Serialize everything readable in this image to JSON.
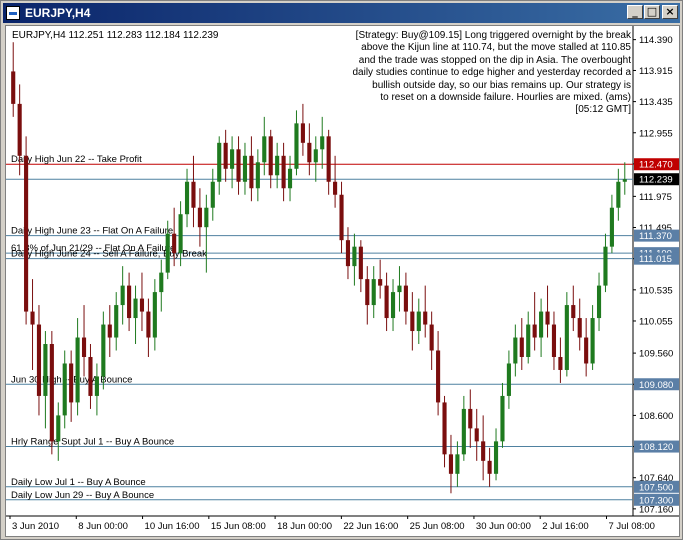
{
  "window": {
    "title": "EURJPY,H4",
    "min_label": "_",
    "max_label": "□",
    "close_label": "×"
  },
  "header": {
    "symbol_line": "EURJPY,H4  112.251 112.283 112.184 112.239"
  },
  "commentary": "[Strategy: Buy@109.15] Long triggered overnight by the break\nabove the Kijun line at 110.74, but the move stalled at 110.85\nand the trade was stopped on the dip in Asia. The overbought\ndaily studies continue to edge higher and yesterday recorded a\nbullish outside day, so our bias remains up. Our strategy is\nto reset on a downside failure. Hourlies are mixed. (ams)\n[05:12 GMT]",
  "colors": {
    "bull": "#1f7a1f",
    "bear": "#7a0e0e",
    "level_line": "#4f81a0",
    "tp_line": "#c00000",
    "current_tag": "#000000",
    "level_tag": "#5b7fa6"
  },
  "chart_data": {
    "type": "candlestick",
    "ylim": [
      107.16,
      114.5
    ],
    "price_ticks": [
      "114.390",
      "113.915",
      "113.435",
      "112.955",
      "112.475",
      "111.975",
      "111.495",
      "111.015",
      "110.535",
      "110.055",
      "109.560",
      "109.080",
      "108.600",
      "108.120",
      "107.640",
      "107.160"
    ],
    "x_ticks": [
      "3 Jun 2010",
      "8 Jun 00:00",
      "10 Jun 16:00",
      "15 Jun 08:00",
      "18 Jun 00:00",
      "22 Jun 16:00",
      "25 Jun 08:00",
      "30 Jun 00:00",
      "2 Jul 16:00",
      "7 Jul 08:00"
    ],
    "current_price": {
      "value": 112.239,
      "label": "112.239"
    },
    "levels": [
      {
        "text": "Daily High Jun 22 -- Take Profit",
        "price": 112.47,
        "tag": "112.470",
        "kind": "tp"
      },
      {
        "text": "Daily High June 23 -- Flat On A Failure",
        "price": 111.37,
        "tag": "111.370",
        "kind": "level"
      },
      {
        "text": "61.8% of Jun 21/29 -- Flat On A Failure",
        "price": 111.1,
        "tag": "111.100",
        "kind": "level"
      },
      {
        "text": "Daily High June 24 -- Sell A Failure, Buy Break",
        "price": 111.015,
        "tag": "111.015",
        "kind": "level"
      },
      {
        "text": "Jun 30 High -- Buy A Bounce",
        "price": 109.08,
        "tag": "109.080",
        "kind": "level"
      },
      {
        "text": "Hrly Range Supt Jul 1 -- Buy A Bounce",
        "price": 108.12,
        "tag": "108.120",
        "kind": "level"
      },
      {
        "text": "Daily Low Jul 1 -- Buy A Bounce",
        "price": 107.5,
        "tag": "107.500",
        "kind": "level"
      },
      {
        "text": "Daily Low Jun 29 -- Buy A Bounce",
        "price": 107.3,
        "tag": "107.300",
        "kind": "level"
      }
    ],
    "ohlc": [
      [
        113.9,
        114.35,
        113.2,
        113.4
      ],
      [
        113.4,
        113.7,
        112.3,
        112.6
      ],
      [
        112.6,
        112.9,
        110.0,
        110.2
      ],
      [
        110.2,
        110.7,
        109.3,
        110.0
      ],
      [
        110.0,
        110.3,
        108.6,
        108.9
      ],
      [
        108.9,
        109.9,
        108.4,
        109.7
      ],
      [
        109.7,
        109.9,
        108.0,
        108.2
      ],
      [
        108.2,
        108.8,
        107.9,
        108.6
      ],
      [
        108.6,
        109.6,
        108.4,
        109.4
      ],
      [
        109.4,
        109.6,
        108.5,
        108.8
      ],
      [
        108.8,
        110.1,
        108.6,
        109.8
      ],
      [
        109.8,
        110.3,
        109.2,
        109.5
      ],
      [
        109.5,
        109.7,
        108.7,
        108.9
      ],
      [
        108.9,
        109.4,
        108.6,
        109.2
      ],
      [
        109.2,
        110.2,
        109.0,
        110.0
      ],
      [
        110.0,
        110.3,
        109.5,
        109.8
      ],
      [
        109.8,
        110.5,
        109.6,
        110.3
      ],
      [
        110.3,
        110.9,
        110.0,
        110.6
      ],
      [
        110.6,
        110.8,
        109.9,
        110.1
      ],
      [
        110.1,
        110.6,
        109.7,
        110.4
      ],
      [
        110.4,
        110.8,
        109.9,
        110.2
      ],
      [
        110.2,
        110.4,
        109.5,
        109.8
      ],
      [
        109.8,
        110.7,
        109.6,
        110.5
      ],
      [
        110.5,
        111.0,
        110.2,
        110.8
      ],
      [
        110.8,
        111.6,
        110.7,
        111.4
      ],
      [
        111.4,
        111.8,
        110.9,
        111.1
      ],
      [
        111.1,
        111.9,
        110.9,
        111.7
      ],
      [
        111.7,
        112.4,
        111.5,
        112.2
      ],
      [
        112.2,
        112.6,
        111.5,
        111.8
      ],
      [
        111.8,
        112.1,
        111.2,
        111.5
      ],
      [
        111.5,
        112.0,
        110.8,
        111.8
      ],
      [
        111.8,
        112.4,
        111.6,
        112.2
      ],
      [
        112.2,
        112.9,
        112.0,
        112.8
      ],
      [
        112.8,
        113.0,
        112.2,
        112.4
      ],
      [
        112.4,
        112.9,
        112.1,
        112.7
      ],
      [
        112.7,
        112.9,
        112.0,
        112.2
      ],
      [
        112.2,
        112.8,
        112.0,
        112.6
      ],
      [
        112.6,
        112.9,
        111.9,
        112.1
      ],
      [
        112.1,
        112.7,
        111.9,
        112.5
      ],
      [
        112.5,
        113.2,
        112.3,
        112.9
      ],
      [
        112.9,
        113.0,
        112.1,
        112.3
      ],
      [
        112.3,
        112.8,
        112.1,
        112.6
      ],
      [
        112.6,
        112.8,
        111.9,
        112.1
      ],
      [
        112.1,
        112.6,
        111.9,
        112.4
      ],
      [
        112.4,
        113.3,
        112.3,
        113.1
      ],
      [
        113.1,
        113.4,
        112.6,
        112.8
      ],
      [
        112.8,
        113.1,
        112.3,
        112.5
      ],
      [
        112.5,
        112.9,
        112.2,
        112.7
      ],
      [
        112.7,
        113.2,
        112.4,
        112.9
      ],
      [
        112.9,
        113.0,
        112.0,
        112.2
      ],
      [
        112.2,
        112.6,
        111.8,
        112.0
      ],
      [
        112.0,
        112.2,
        111.1,
        111.3
      ],
      [
        111.3,
        111.5,
        110.7,
        110.9
      ],
      [
        110.9,
        111.4,
        110.6,
        111.2
      ],
      [
        111.2,
        111.3,
        110.5,
        110.7
      ],
      [
        110.7,
        110.9,
        110.0,
        110.3
      ],
      [
        110.3,
        110.9,
        110.1,
        110.7
      ],
      [
        110.7,
        111.0,
        110.4,
        110.6
      ],
      [
        110.6,
        110.8,
        109.9,
        110.1
      ],
      [
        110.1,
        110.7,
        109.9,
        110.5
      ],
      [
        110.5,
        110.9,
        110.2,
        110.6
      ],
      [
        110.6,
        110.8,
        110.0,
        110.2
      ],
      [
        110.2,
        110.5,
        109.6,
        109.9
      ],
      [
        109.9,
        110.4,
        109.7,
        110.2
      ],
      [
        110.2,
        110.6,
        109.8,
        110.0
      ],
      [
        110.0,
        110.2,
        109.3,
        109.6
      ],
      [
        109.6,
        109.9,
        108.6,
        108.8
      ],
      [
        108.8,
        108.9,
        107.8,
        108.0
      ],
      [
        108.0,
        108.3,
        107.4,
        107.7
      ],
      [
        107.7,
        108.2,
        107.5,
        108.0
      ],
      [
        108.0,
        108.9,
        107.9,
        108.7
      ],
      [
        108.7,
        109.0,
        108.1,
        108.4
      ],
      [
        108.4,
        108.7,
        107.9,
        108.2
      ],
      [
        108.2,
        108.6,
        107.6,
        107.9
      ],
      [
        107.9,
        108.1,
        107.5,
        107.7
      ],
      [
        107.7,
        108.4,
        107.6,
        108.2
      ],
      [
        108.2,
        109.1,
        108.1,
        108.9
      ],
      [
        108.9,
        109.6,
        108.7,
        109.4
      ],
      [
        109.4,
        110.0,
        109.2,
        109.8
      ],
      [
        109.8,
        110.1,
        109.3,
        109.5
      ],
      [
        109.5,
        110.2,
        109.4,
        110.0
      ],
      [
        110.0,
        110.5,
        109.6,
        109.8
      ],
      [
        109.8,
        110.4,
        109.5,
        110.2
      ],
      [
        110.2,
        110.6,
        109.8,
        110.0
      ],
      [
        110.0,
        110.2,
        109.3,
        109.5
      ],
      [
        109.5,
        109.8,
        109.1,
        109.3
      ],
      [
        109.3,
        110.5,
        109.2,
        110.3
      ],
      [
        110.3,
        110.6,
        109.9,
        110.1
      ],
      [
        110.1,
        110.4,
        109.6,
        109.8
      ],
      [
        109.8,
        110.1,
        109.2,
        109.4
      ],
      [
        109.4,
        110.3,
        109.3,
        110.1
      ],
      [
        110.1,
        110.8,
        109.9,
        110.6
      ],
      [
        110.6,
        111.4,
        110.5,
        111.2
      ],
      [
        111.2,
        112.0,
        111.1,
        111.8
      ],
      [
        111.8,
        112.4,
        111.6,
        112.2
      ],
      [
        112.2,
        112.5,
        112.0,
        112.24
      ]
    ]
  }
}
